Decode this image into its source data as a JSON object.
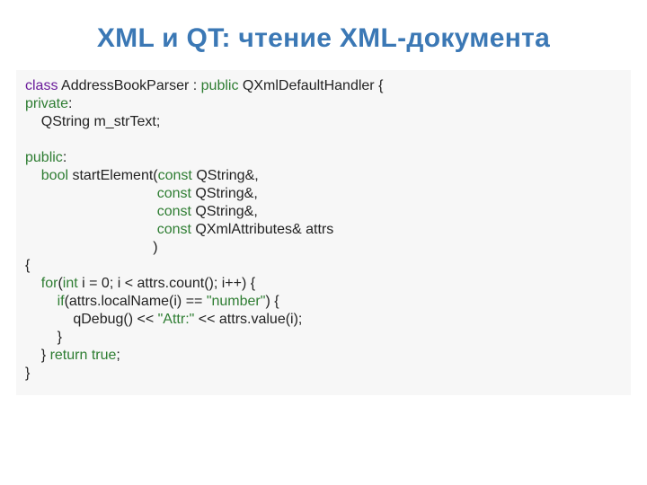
{
  "title": "XML и QT: чтение XML-документа",
  "code": {
    "kw": {
      "class": "class",
      "public": "public",
      "private": "private",
      "bool": "bool",
      "const": "const",
      "for": "for",
      "int": "int",
      "if": "if",
      "return": "return",
      "true": "true"
    },
    "l1a": " AddressBookParser : ",
    "l1b": " QXmlDefaultHandler {",
    "l2": ":",
    "l3": "    QString m_strText;",
    "l4": "",
    "l5": ":",
    "l6a": "    ",
    "l6b": " startElement(",
    "l6c": " QString&,",
    "l7a": "                                 ",
    "l7b": " QString&,",
    "l8a": "                                 ",
    "l8b": " QString&,",
    "l9a": "                                 ",
    "l9b": " QXmlAttributes& attrs",
    "l10": "                                )",
    "l11": "{",
    "l12a": "    ",
    "l12b": "(",
    "l12c": " i = 0; i < attrs.count(); i++) {",
    "l13a": "        ",
    "l13b": "(attrs.localName(i) == ",
    "l13s": "\"number\"",
    "l13c": ") {",
    "l14a": "            qDebug() << ",
    "l14s": "\"Attr:\"",
    "l14b": " << attrs.value(i);",
    "l15": "        }",
    "l16a": "    } ",
    "l16b": " ",
    "l16c": ";",
    "l17": "}"
  }
}
